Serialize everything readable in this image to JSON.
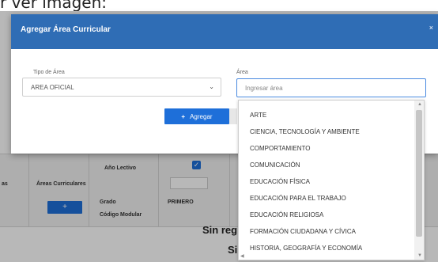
{
  "caption": "r ver imagen:",
  "background_table": {
    "col_area": "Áreas Curriculares",
    "col_year": "Año Lectivo",
    "grade_label": "Grado",
    "grade_value": "PRIMERO",
    "modular_label": "Código Modular",
    "add_symbol": "+",
    "check_symbol": "✓",
    "empty_text": "Sin regi",
    "empty_text_2": "Sir",
    "left_fragment": "as"
  },
  "modal": {
    "title": "Agregar Área Curricular",
    "close_symbol": "×",
    "tipo_label": "Tipo de Área",
    "tipo_value": "AREA OFICIAL",
    "area_label": "Área",
    "area_placeholder": "Ingresar área",
    "add_button": "Agregar",
    "add_button_icon": "+"
  },
  "dropdown": {
    "options": [
      "ARTE",
      "CIENCIA, TECNOLOGÍA Y AMBIENTE",
      "COMPORTAMIENTO",
      "COMUNICACIÓN",
      "EDUCACIÓN FÍSICA",
      "EDUCACIÓN PARA EL TRABAJO",
      "EDUCACIÓN RELIGIOSA",
      "FORMACIÓN CIUDADANA Y CÍVICA",
      "HISTORIA, GEOGRAFÍA Y ECONOMÍA"
    ]
  },
  "colors": {
    "header": "#2f6db5",
    "primary": "#1e6fd9"
  }
}
